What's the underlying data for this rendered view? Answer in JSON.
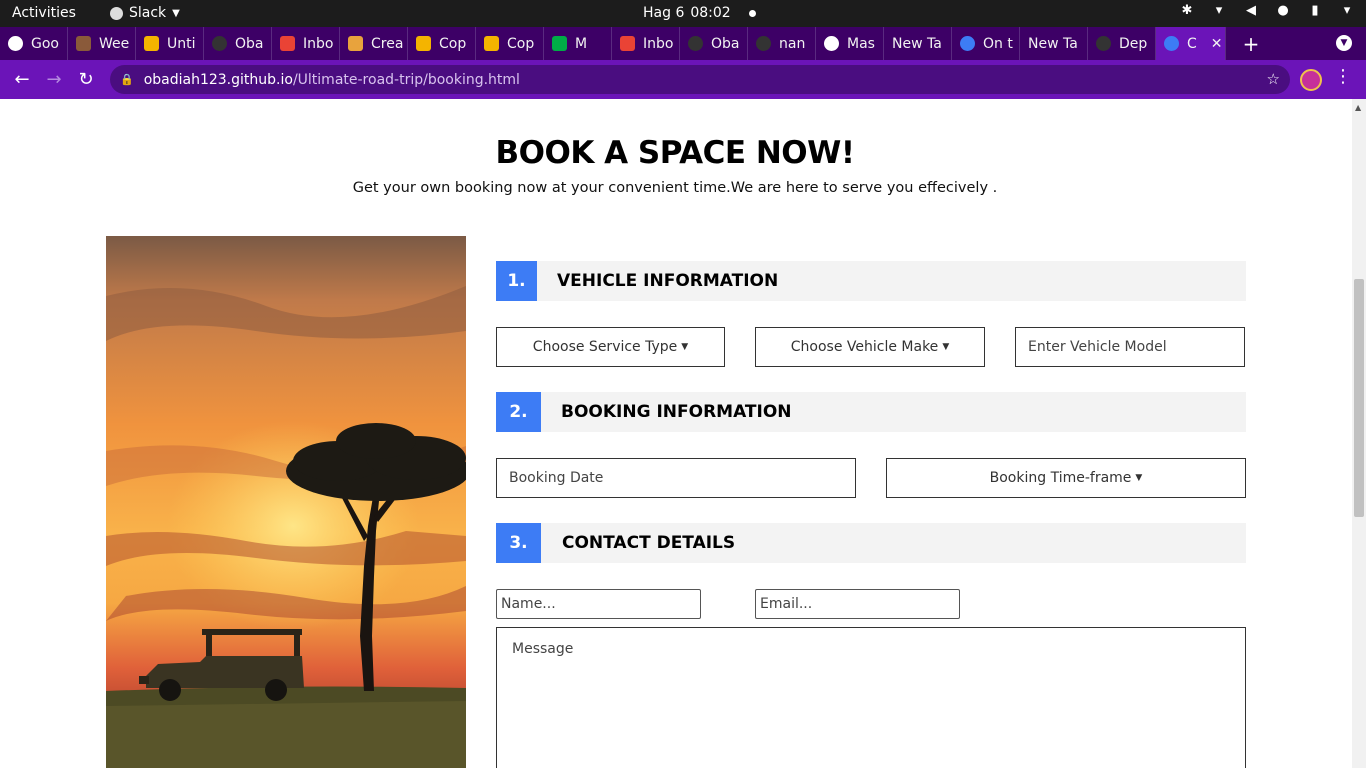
{
  "system_bar": {
    "activities": "Activities",
    "app_name": "Slack",
    "date": "Hag 6",
    "time": "08:02"
  },
  "tabs": [
    {
      "label": "Goo",
      "icon": "globe-icon",
      "color": "#ffffff"
    },
    {
      "label": "Wee",
      "icon": "plant-icon",
      "color": "#8a5a3a"
    },
    {
      "label": "Unti",
      "icon": "slides-icon",
      "color": "#f4b400"
    },
    {
      "label": "Oba",
      "icon": "github-icon",
      "color": "#333333"
    },
    {
      "label": "Inbo",
      "icon": "gmail-icon",
      "color": "#ea4335"
    },
    {
      "label": "Crea",
      "icon": "pencil-icon",
      "color": "#e8a33d"
    },
    {
      "label": "Cop",
      "icon": "slides-icon",
      "color": "#f4b400"
    },
    {
      "label": "Cop",
      "icon": "slides-icon",
      "color": "#f4b400"
    },
    {
      "label": "M",
      "icon": "meet-icon",
      "color": "#00ac47"
    },
    {
      "label": "Inbo",
      "icon": "gmail-icon",
      "color": "#ea4335"
    },
    {
      "label": "Oba",
      "icon": "github-icon",
      "color": "#333333"
    },
    {
      "label": "nan",
      "icon": "github-icon",
      "color": "#333333"
    },
    {
      "label": "Mas",
      "icon": "globe-icon",
      "color": "#ffffff"
    },
    {
      "label": "New Ta",
      "icon": "",
      "color": ""
    },
    {
      "label": "On t",
      "icon": "site-icon",
      "color": "#3d7cf5"
    },
    {
      "label": "New Ta",
      "icon": "",
      "color": ""
    },
    {
      "label": "Dep",
      "icon": "github-icon",
      "color": "#333333"
    },
    {
      "label": "C",
      "icon": "site-icon",
      "color": "#3d7cf5",
      "active": true
    }
  ],
  "address_bar": {
    "host": "obadiah123.github.io",
    "path": "/Ultimate-road-trip/booking.html"
  },
  "page": {
    "heading": "BOOK A SPACE NOW!",
    "subheading": "Get your own booking now at your convenient time.We are here to serve you effecively ."
  },
  "sections": {
    "vehicle": {
      "number": "1.",
      "title": "VEHICLE INFORMATION"
    },
    "booking": {
      "number": "2.",
      "title": "BOOKING INFORMATION"
    },
    "contact": {
      "number": "3.",
      "title": "CONTACT DETAILS"
    }
  },
  "form": {
    "service_type": "Choose Service Type",
    "vehicle_make": "Choose Vehicle Make",
    "vehicle_model_placeholder": "Enter Vehicle Model",
    "booking_date_placeholder": "Booking Date",
    "booking_timeframe": "Booking Time-frame",
    "name_placeholder": "Name...",
    "email_placeholder": "Email...",
    "message_placeholder": "Message"
  },
  "colors": {
    "accent": "#3d7cf5",
    "browser_frame": "#6b14b8",
    "section_bg": "#f3f3f3"
  }
}
